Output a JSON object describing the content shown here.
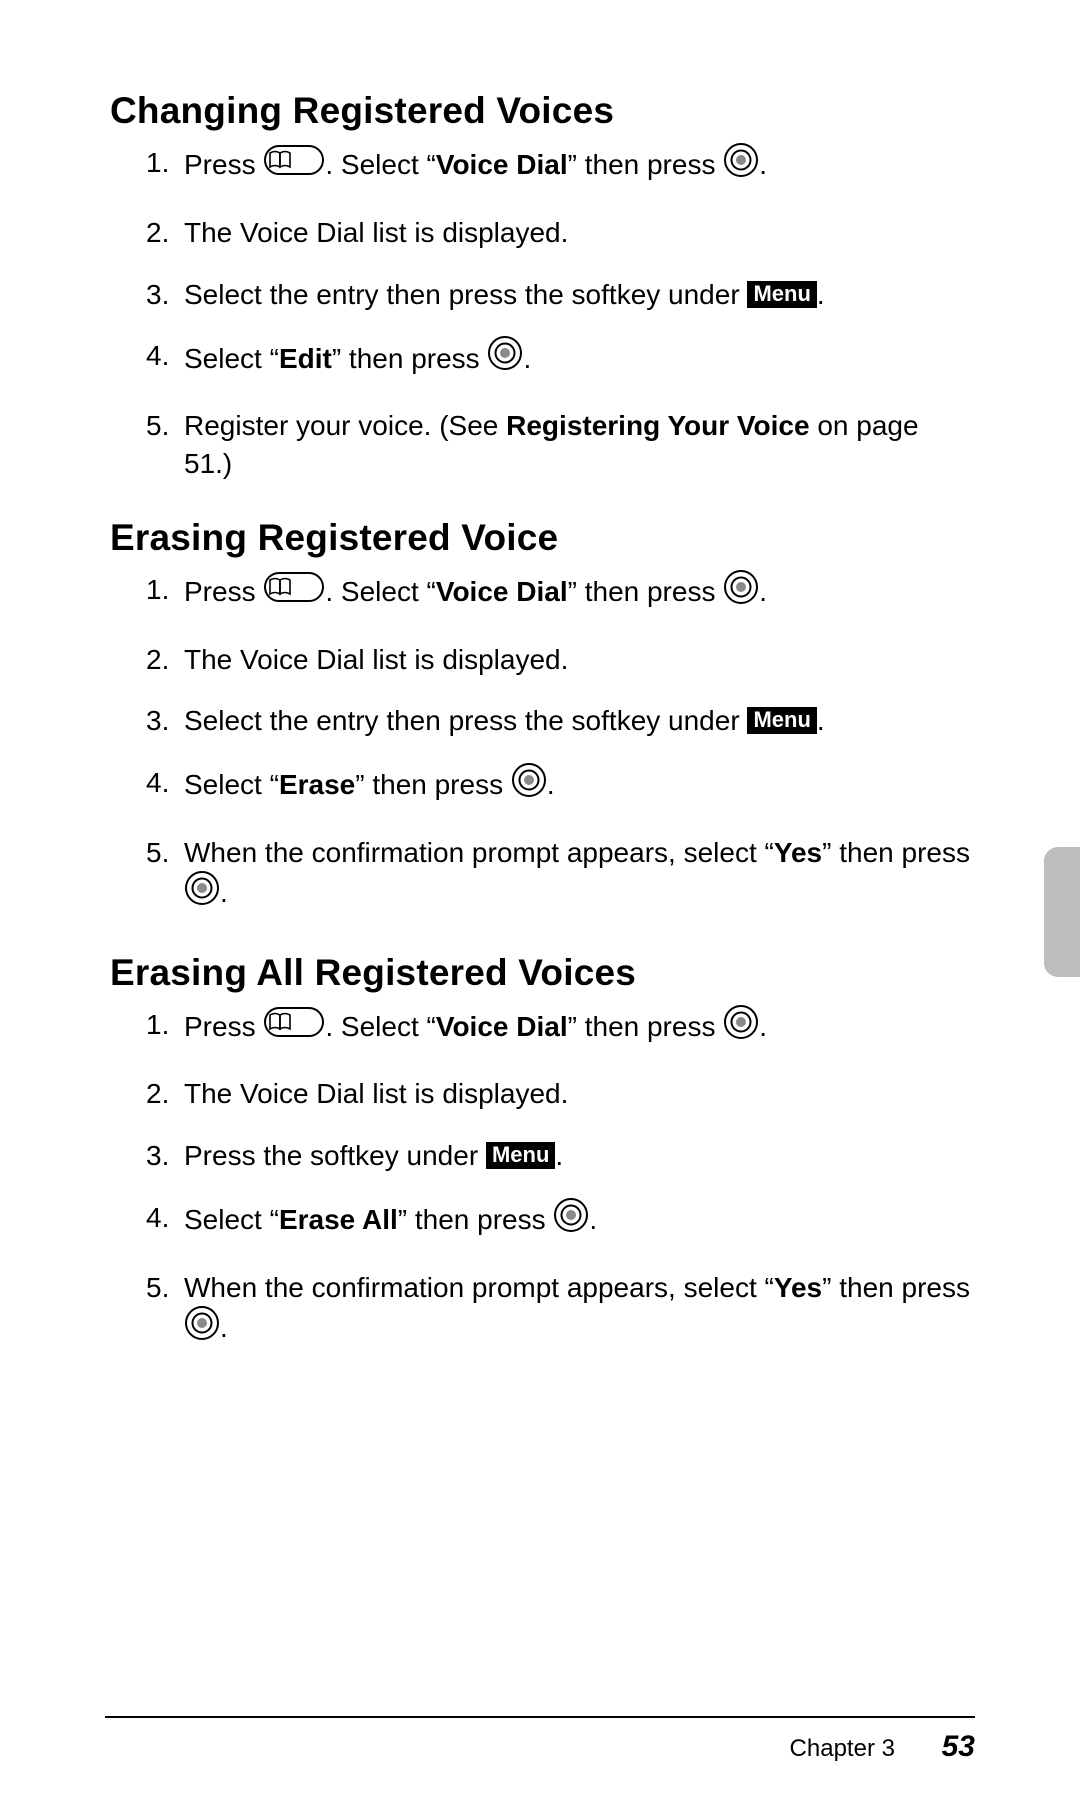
{
  "icons": {
    "book_key": "phone-book-key-icon",
    "ok_key": "ok-center-key-icon",
    "menu_badge": "Menu"
  },
  "footer": {
    "chapter": "Chapter 3",
    "page_number": "53"
  },
  "sections": [
    {
      "heading": "Changing Registered Voices",
      "steps": [
        {
          "num": "1.",
          "parts": [
            {
              "t": "text",
              "v": "Press "
            },
            {
              "t": "bookkey"
            },
            {
              "t": "text",
              "v": ". Select “"
            },
            {
              "t": "bold",
              "v": "Voice Dial"
            },
            {
              "t": "text",
              "v": "” then press "
            },
            {
              "t": "okkey"
            },
            {
              "t": "text",
              "v": "."
            }
          ]
        },
        {
          "num": "2.",
          "parts": [
            {
              "t": "text",
              "v": "The Voice Dial list is displayed."
            }
          ]
        },
        {
          "num": "3.",
          "parts": [
            {
              "t": "text",
              "v": "Select the entry then press the softkey under "
            },
            {
              "t": "menu"
            },
            {
              "t": "text",
              "v": "."
            }
          ]
        },
        {
          "num": "4.",
          "parts": [
            {
              "t": "text",
              "v": "Select “"
            },
            {
              "t": "bold",
              "v": "Edit"
            },
            {
              "t": "text",
              "v": "” then press "
            },
            {
              "t": "okkey"
            },
            {
              "t": "text",
              "v": "."
            }
          ]
        },
        {
          "num": "5.",
          "parts": [
            {
              "t": "text",
              "v": "Register your voice. (See "
            },
            {
              "t": "bold",
              "v": "Registering Your Voice"
            },
            {
              "t": "text",
              "v": " on page 51.)"
            }
          ]
        }
      ]
    },
    {
      "heading": "Erasing Registered Voice",
      "steps": [
        {
          "num": "1.",
          "parts": [
            {
              "t": "text",
              "v": "Press "
            },
            {
              "t": "bookkey"
            },
            {
              "t": "text",
              "v": ". Select “"
            },
            {
              "t": "bold",
              "v": "Voice Dial"
            },
            {
              "t": "text",
              "v": "” then press "
            },
            {
              "t": "okkey"
            },
            {
              "t": "text",
              "v": "."
            }
          ]
        },
        {
          "num": "2.",
          "parts": [
            {
              "t": "text",
              "v": "The Voice Dial list is displayed."
            }
          ]
        },
        {
          "num": "3.",
          "parts": [
            {
              "t": "text",
              "v": "Select the entry then press the softkey under "
            },
            {
              "t": "menu"
            },
            {
              "t": "text",
              "v": "."
            }
          ]
        },
        {
          "num": "4.",
          "parts": [
            {
              "t": "text",
              "v": "Select “"
            },
            {
              "t": "bold",
              "v": "Erase"
            },
            {
              "t": "text",
              "v": "” then press "
            },
            {
              "t": "okkey"
            },
            {
              "t": "text",
              "v": "."
            }
          ]
        },
        {
          "num": "5.",
          "parts": [
            {
              "t": "text",
              "v": "When the confirmation prompt appears, select “"
            },
            {
              "t": "bold",
              "v": "Yes"
            },
            {
              "t": "text",
              "v": "” then press "
            },
            {
              "t": "okkey"
            },
            {
              "t": "text",
              "v": "."
            }
          ]
        }
      ]
    },
    {
      "heading": "Erasing All Registered Voices",
      "steps": [
        {
          "num": "1.",
          "parts": [
            {
              "t": "text",
              "v": "Press "
            },
            {
              "t": "bookkey"
            },
            {
              "t": "text",
              "v": ". Select “"
            },
            {
              "t": "bold",
              "v": "Voice Dial"
            },
            {
              "t": "text",
              "v": "” then press "
            },
            {
              "t": "okkey"
            },
            {
              "t": "text",
              "v": "."
            }
          ]
        },
        {
          "num": "2.",
          "parts": [
            {
              "t": "text",
              "v": "The Voice Dial list is displayed."
            }
          ]
        },
        {
          "num": "3.",
          "parts": [
            {
              "t": "text",
              "v": "Press the softkey under "
            },
            {
              "t": "menu"
            },
            {
              "t": "text",
              "v": "."
            }
          ]
        },
        {
          "num": "4.",
          "parts": [
            {
              "t": "text",
              "v": "Select “"
            },
            {
              "t": "bold",
              "v": "Erase All"
            },
            {
              "t": "text",
              "v": "” then press "
            },
            {
              "t": "okkey"
            },
            {
              "t": "text",
              "v": "."
            }
          ]
        },
        {
          "num": "5.",
          "parts": [
            {
              "t": "text",
              "v": "When the confirmation prompt appears, select “"
            },
            {
              "t": "bold",
              "v": "Yes"
            },
            {
              "t": "text",
              "v": "” then press "
            },
            {
              "t": "okkey"
            },
            {
              "t": "text",
              "v": "."
            }
          ]
        }
      ]
    }
  ]
}
